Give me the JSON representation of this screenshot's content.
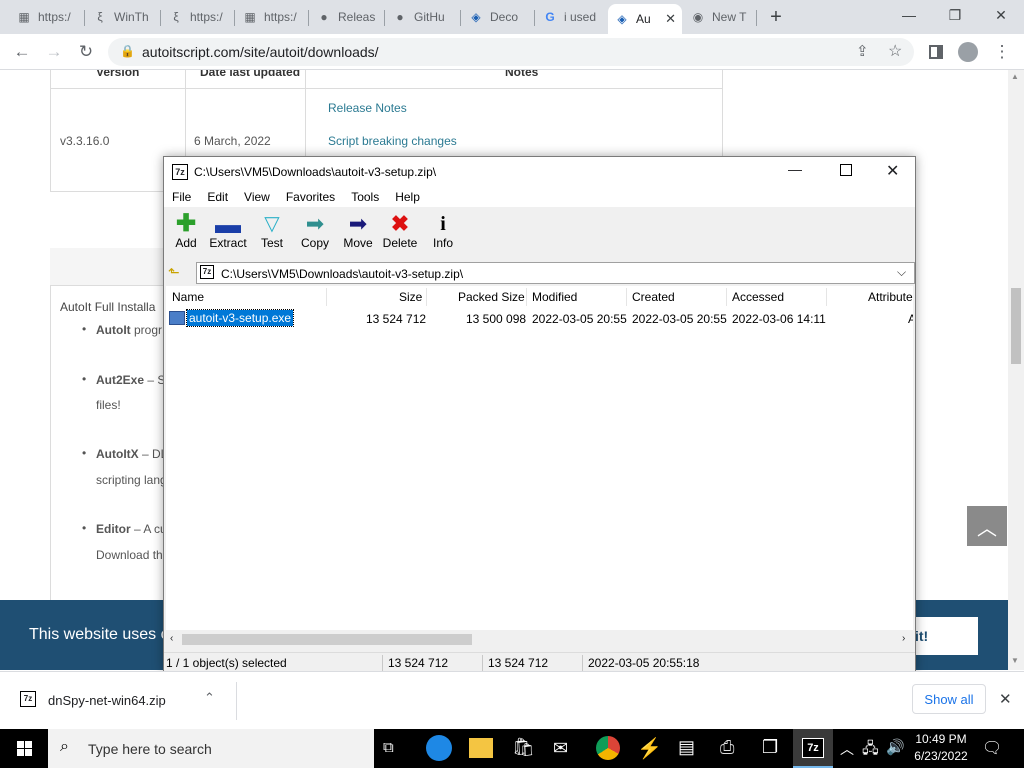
{
  "browser": {
    "tabs": [
      {
        "label": "https:/",
        "icon": "regex-icon"
      },
      {
        "label": "WinTh",
        "icon": "squiggle-icon"
      },
      {
        "label": "https:/",
        "icon": "squiggle-icon"
      },
      {
        "label": "https:/",
        "icon": "regex-icon"
      },
      {
        "label": "Releas",
        "icon": "github-icon"
      },
      {
        "label": "GitHu",
        "icon": "github-icon"
      },
      {
        "label": "Deco",
        "icon": "app-icon"
      },
      {
        "label": "i used",
        "icon": "google-icon"
      },
      {
        "label": "Au",
        "icon": "autoit-icon",
        "active": true
      },
      {
        "label": "New T",
        "icon": "chrome-icon"
      }
    ],
    "url": "autoitscript.com/site/autoit/downloads/"
  },
  "page": {
    "table": {
      "headers": [
        "Version",
        "Date last updated",
        "Notes"
      ],
      "row": {
        "version": "v3.3.16.0",
        "date": "6 March, 2022",
        "notes": [
          "Release Notes",
          "Script breaking changes"
        ]
      }
    },
    "section_title": "AutoIt Full Installa",
    "bullets": [
      {
        "title": "AutoIt",
        "rest": " progr",
        "cont": ""
      },
      {
        "title": "Aut2Exe",
        "rest": " – Sc",
        "cont": "files!"
      },
      {
        "title": "AutoItX",
        "rest": " – DL",
        "cont": "scripting lang"
      },
      {
        "title": "Editor",
        "rest": " – A cu",
        "cont": "Download th"
      }
    ],
    "cookie_text": "This website uses c",
    "cookie_button": "it!"
  },
  "sevenzip": {
    "title": "C:\\Users\\VM5\\Downloads\\autoit-v3-setup.zip\\",
    "menu": [
      "File",
      "Edit",
      "View",
      "Favorites",
      "Tools",
      "Help"
    ],
    "toolbar": [
      {
        "label": "Add",
        "icon": "add-icon"
      },
      {
        "label": "Extract",
        "icon": "extract-icon"
      },
      {
        "label": "Test",
        "icon": "test-icon"
      },
      {
        "label": "Copy",
        "icon": "copy-icon"
      },
      {
        "label": "Move",
        "icon": "move-icon"
      },
      {
        "label": "Delete",
        "icon": "delete-icon"
      },
      {
        "label": "Info",
        "icon": "info-icon"
      }
    ],
    "path": "C:\\Users\\VM5\\Downloads\\autoit-v3-setup.zip\\",
    "columns": [
      "Name",
      "Size",
      "Packed Size",
      "Modified",
      "Created",
      "Accessed",
      "Attribute"
    ],
    "file": {
      "name": "autoit-v3-setup.exe",
      "size": "13 524 712",
      "packed": "13 500 098",
      "modified": "2022-03-05 20:55",
      "created": "2022-03-05 20:55",
      "accessed": "2022-03-06 14:11",
      "attr": "A"
    },
    "status": {
      "selected": "1 / 1 object(s) selected",
      "size": "13 524 712",
      "size2": "13 524 712",
      "date": "2022-03-05 20:55:18"
    }
  },
  "downloads": {
    "file": "dnSpy-net-win64.zip",
    "show_all": "Show all"
  },
  "taskbar": {
    "search_placeholder": "Type here to search",
    "time": "10:49 PM",
    "date": "6/23/2022"
  },
  "colors": {
    "selection": "#0078d7",
    "cookie_bar": "#1f4f73",
    "link": "#2b7a92"
  }
}
